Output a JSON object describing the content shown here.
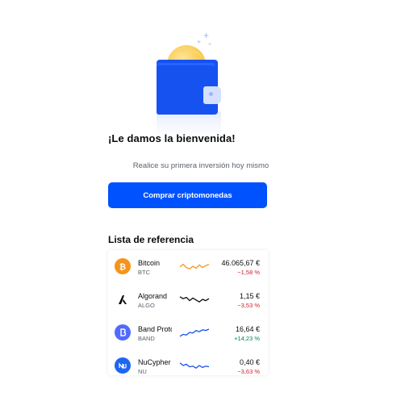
{
  "welcome": {
    "title": "¡Le damos la bienvenida!",
    "subtitle": "Realice su primera inversión hoy mismo",
    "cta_label": "Comprar criptomonedas"
  },
  "watchlist": {
    "title": "Lista de referencia",
    "assets": [
      {
        "name": "Bitcoin",
        "ticker": "BTC",
        "price": "46.065,67 €",
        "change": "−1,58 %",
        "trend": "down",
        "icon": "bitcoin-icon",
        "icon_color": "#f7931a",
        "line_color": "#f7931a",
        "spark": [
          0.55,
          0.35,
          0.6,
          0.7,
          0.5,
          0.65,
          0.4,
          0.6,
          0.45,
          0.35
        ]
      },
      {
        "name": "Algorand",
        "ticker": "ALGO",
        "price": "1,15 €",
        "change": "−3,53 %",
        "trend": "down",
        "icon": "algorand-icon",
        "icon_color": "#000000",
        "line_color": "#0a0b0d",
        "spark": [
          0.3,
          0.45,
          0.35,
          0.6,
          0.4,
          0.55,
          0.7,
          0.5,
          0.6,
          0.45
        ]
      },
      {
        "name": "Band Protocol",
        "ticker": "BAND",
        "price": "16,64 €",
        "change": "+14,23 %",
        "trend": "up",
        "icon": "band-protocol-icon",
        "icon_color": "#516aff",
        "line_color": "#1652f0",
        "spark": [
          0.8,
          0.65,
          0.7,
          0.5,
          0.55,
          0.35,
          0.45,
          0.3,
          0.35,
          0.25
        ]
      },
      {
        "name": "NuCypher",
        "ticker": "NU",
        "price": "0,40 €",
        "change": "−3,63 %",
        "trend": "down",
        "icon": "nucypher-icon",
        "icon_color": "#1e65f3",
        "line_color": "#1652f0",
        "spark": [
          0.3,
          0.5,
          0.4,
          0.6,
          0.55,
          0.7,
          0.5,
          0.65,
          0.55,
          0.6
        ]
      }
    ]
  },
  "colors": {
    "accent": "#0052ff",
    "negative": "#cf202f",
    "positive": "#098551"
  }
}
